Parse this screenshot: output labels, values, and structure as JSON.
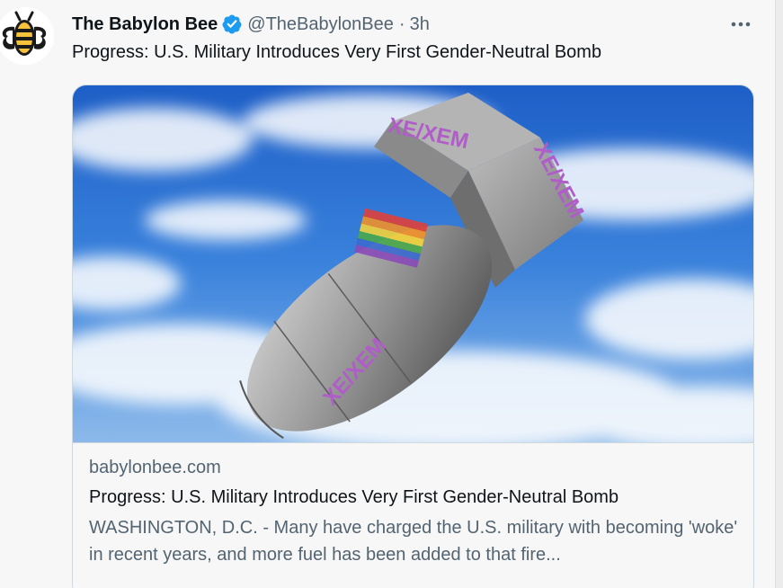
{
  "tweet": {
    "display_name": "The Babylon Bee",
    "handle": "@TheBabylonBee",
    "separator": "·",
    "timestamp": "3h",
    "text": "Progress: U.S. Military Introduces Very First Gender-Neutral Bomb",
    "more_icon": "more-horizontal-icon",
    "verified_icon": "verified-badge-icon",
    "verified_color": "#1d9bf0"
  },
  "card": {
    "image_labels": [
      "XE/XEM",
      "XE/XEM",
      "XE/XEM"
    ],
    "domain": "babylonbee.com",
    "title": "Progress: U.S. Military Introduces Very First Gender-Neutral Bomb",
    "description": "WASHINGTON, D.C. - Many have charged the U.S. military with becoming 'woke' in recent years, and more fuel has been added to that fire..."
  },
  "colors": {
    "logo_yellow": "#f6c23e",
    "label_purple": "#b05cc9",
    "secondary_text": "#536471",
    "border": "#cfd9de"
  }
}
